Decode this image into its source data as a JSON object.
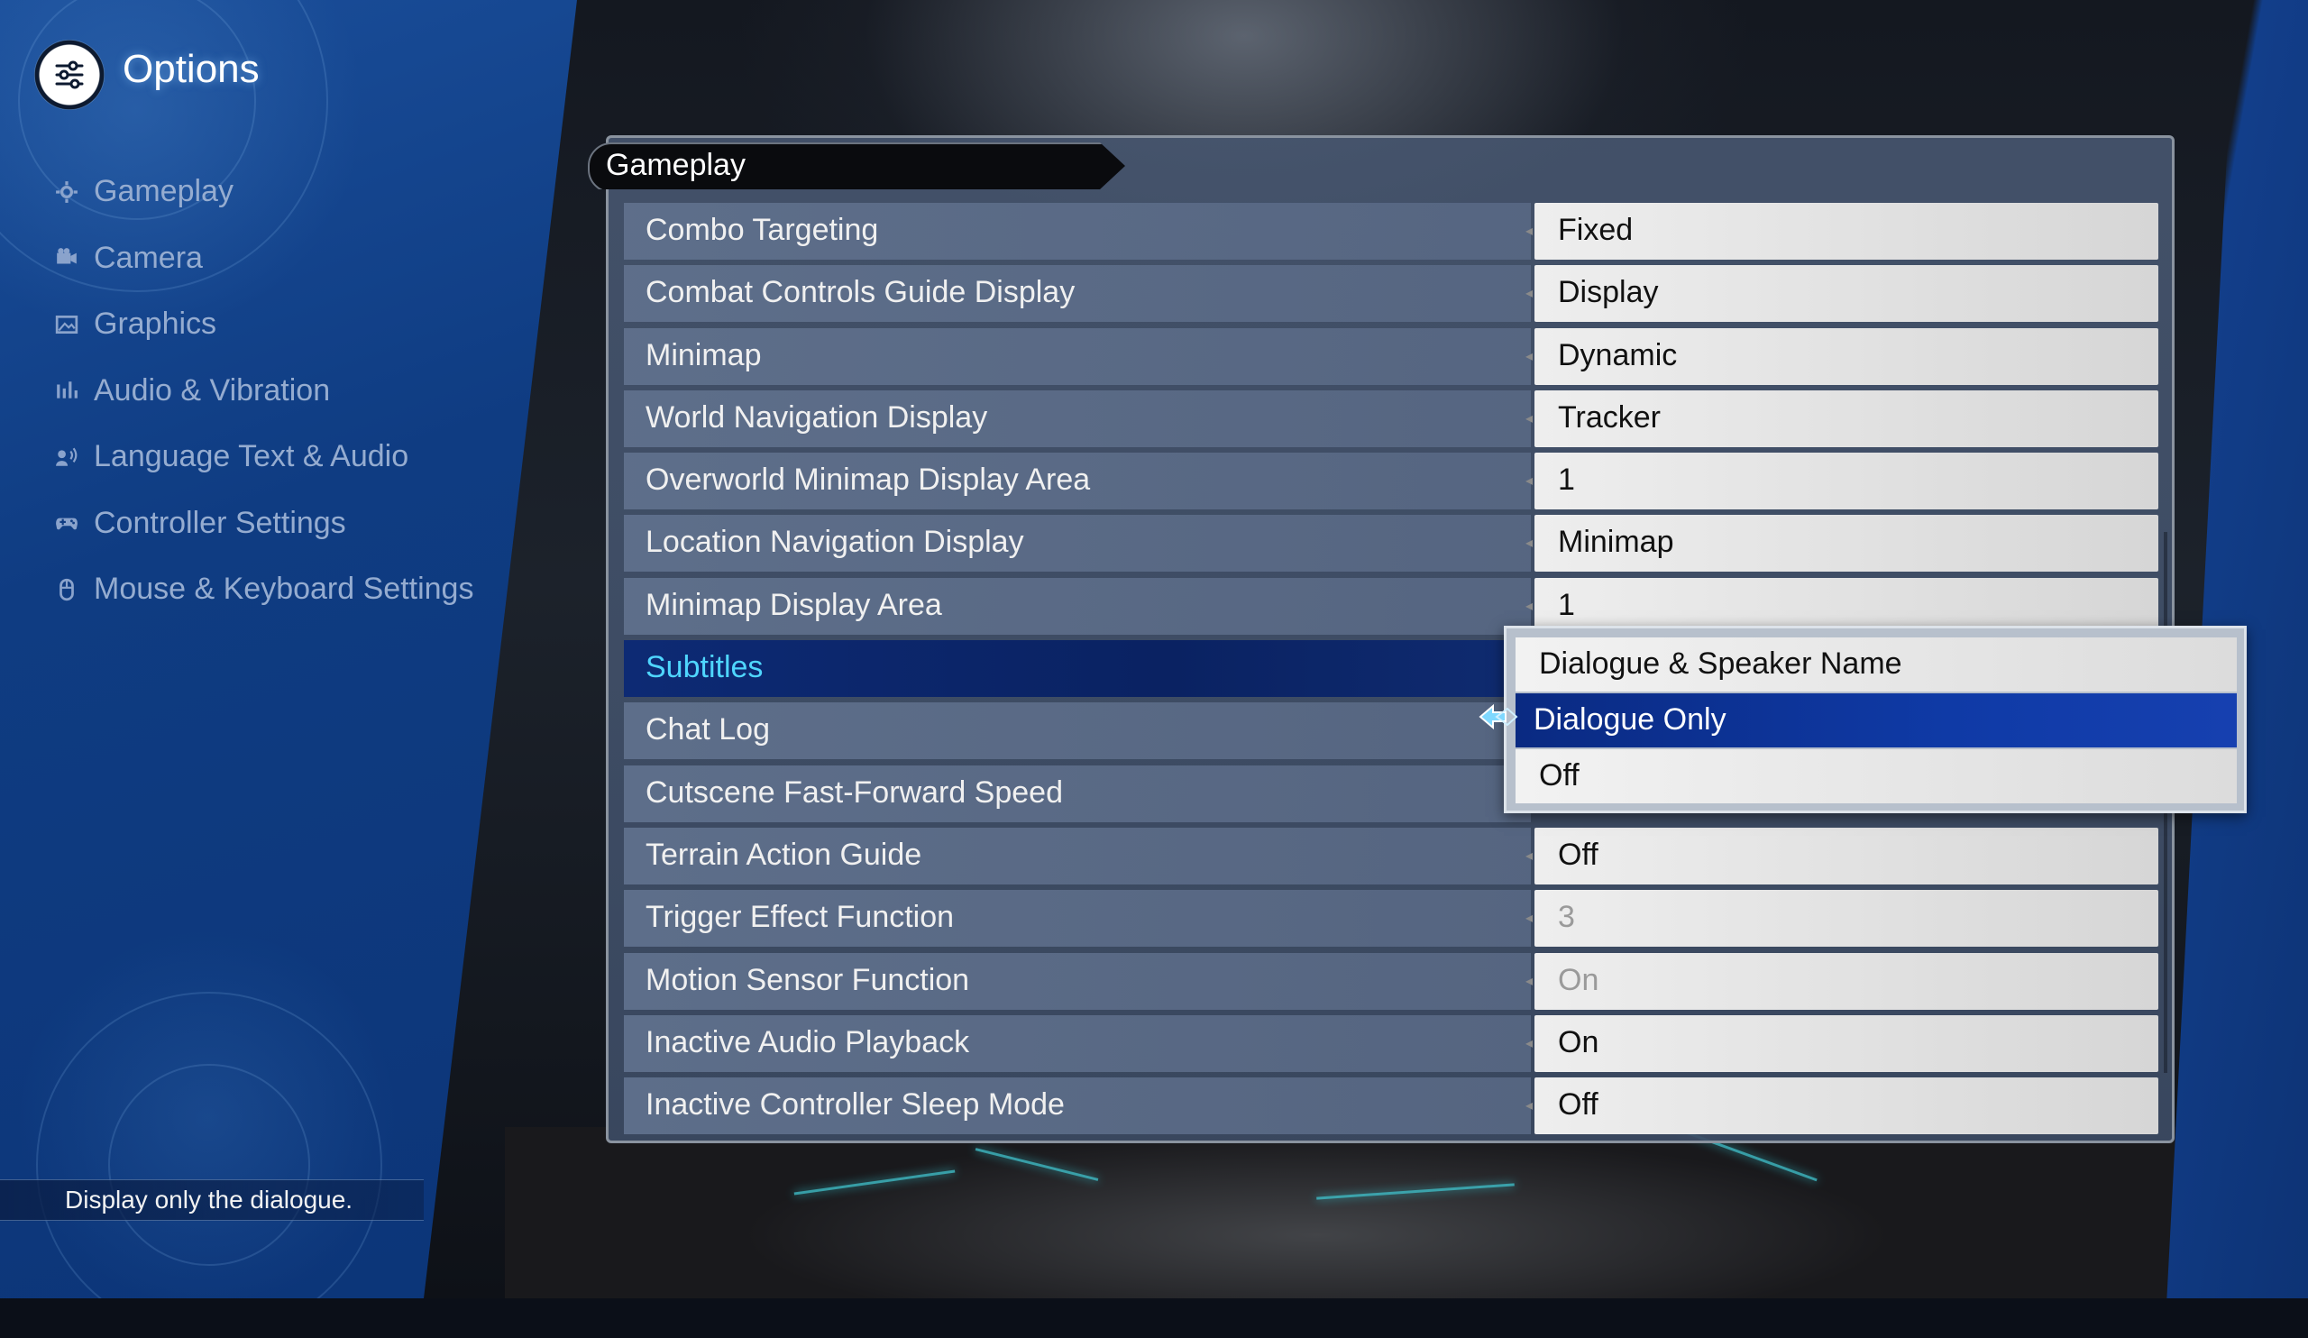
{
  "header": {
    "title": "Options"
  },
  "sidebar": {
    "items": [
      {
        "label": "Gameplay",
        "icon": "gear-icon"
      },
      {
        "label": "Camera",
        "icon": "camera-icon"
      },
      {
        "label": "Graphics",
        "icon": "image-icon"
      },
      {
        "label": "Audio & Vibration",
        "icon": "audio-bars-icon"
      },
      {
        "label": "Language Text & Audio",
        "icon": "speaker-icon"
      },
      {
        "label": "Controller Settings",
        "icon": "gamepad-icon"
      },
      {
        "label": "Mouse & Keyboard Settings",
        "icon": "mouse-icon"
      }
    ]
  },
  "panel": {
    "tab_title": "Gameplay",
    "rows": [
      {
        "label": "Combo Targeting",
        "value": "Fixed"
      },
      {
        "label": "Combat Controls Guide Display",
        "value": "Display"
      },
      {
        "label": "Minimap",
        "value": "Dynamic"
      },
      {
        "label": "World Navigation Display",
        "value": "Tracker"
      },
      {
        "label": "Overworld Minimap Display Area",
        "value": "1"
      },
      {
        "label": "Location Navigation Display",
        "value": "Minimap"
      },
      {
        "label": "Minimap Display Area",
        "value": "1"
      },
      {
        "label": "Subtitles",
        "value": ""
      },
      {
        "label": "Chat Log",
        "value": ""
      },
      {
        "label": "Cutscene Fast-Forward Speed",
        "value": ""
      },
      {
        "label": "Terrain Action Guide",
        "value": "Off"
      },
      {
        "label": "Trigger Effect Function",
        "value": "3"
      },
      {
        "label": "Motion Sensor Function",
        "value": "On"
      },
      {
        "label": "Inactive Audio Playback",
        "value": "On"
      },
      {
        "label": "Inactive Controller Sleep Mode",
        "value": "Off"
      }
    ]
  },
  "dropdown": {
    "options": [
      "Dialogue & Speaker Name",
      "Dialogue Only",
      "Off"
    ],
    "selected": "Dialogue Only"
  },
  "help": {
    "text": "Display only the dialogue."
  },
  "colors": {
    "accent_cyan": "#4fd6ff",
    "selection_blue": "#0f3aa6",
    "sidebar_blue": "#0f3c82"
  }
}
